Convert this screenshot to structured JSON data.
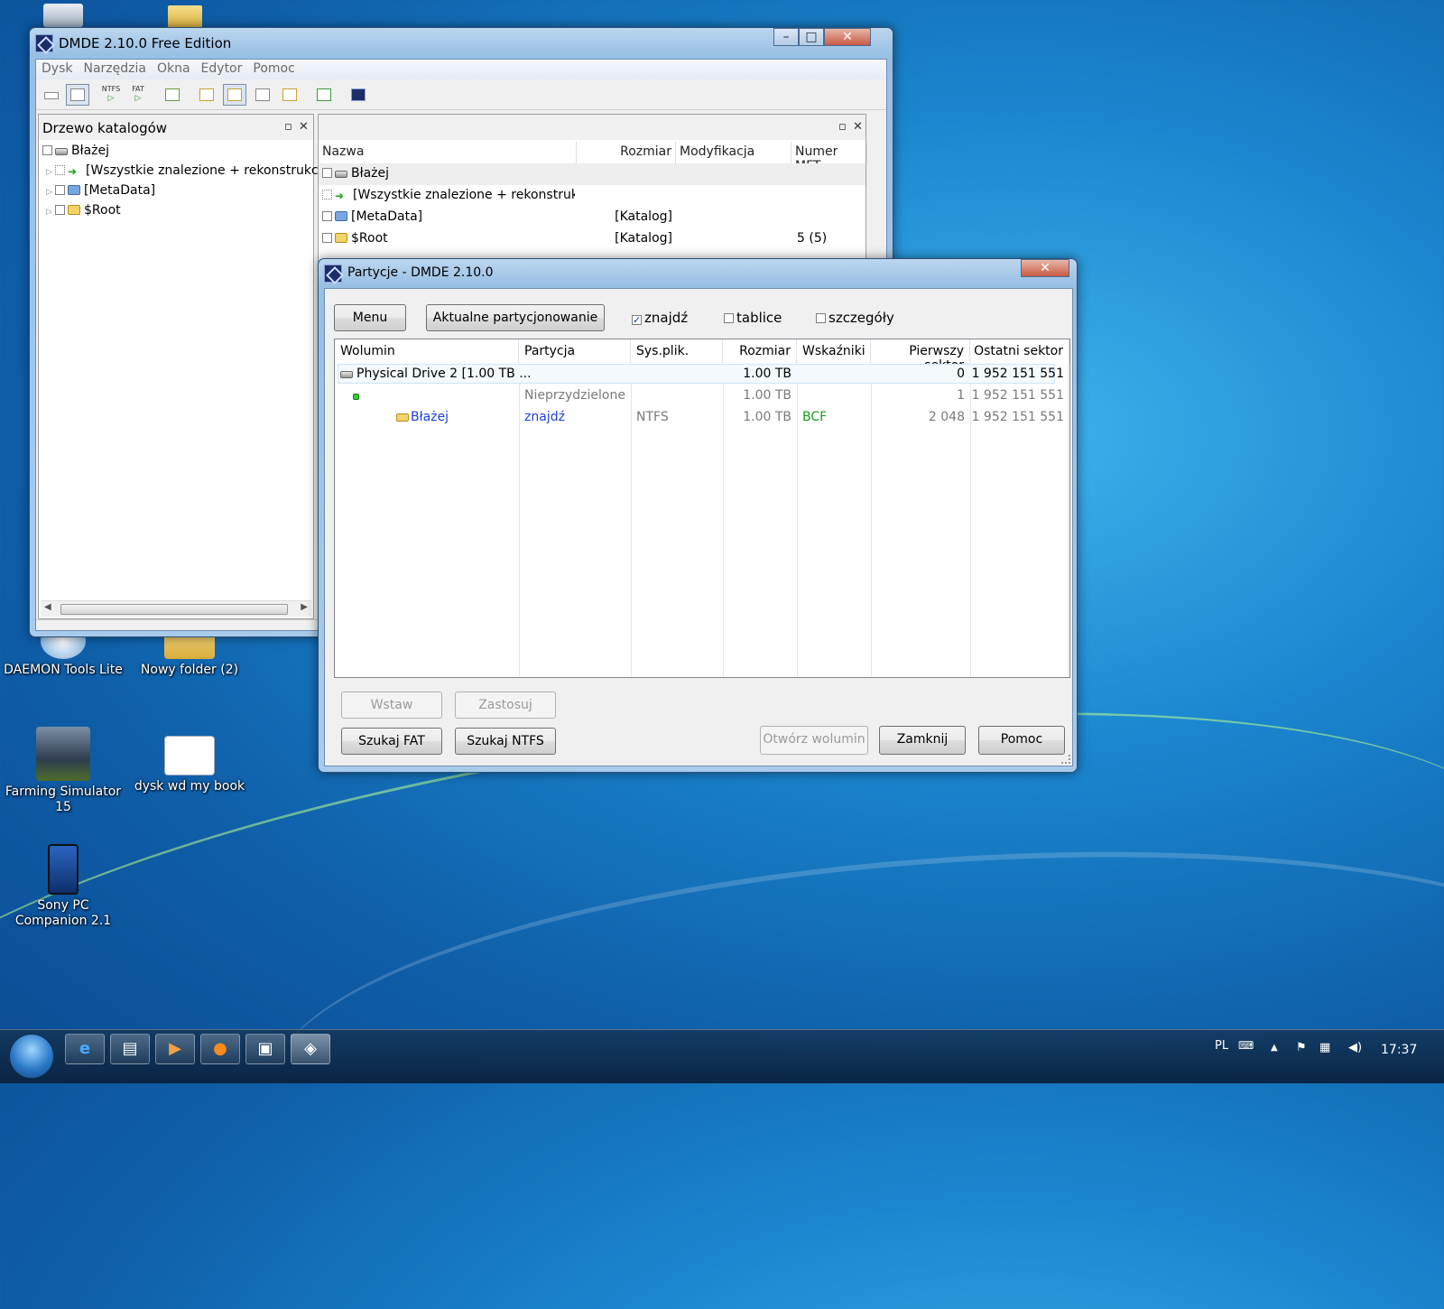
{
  "desktop": {
    "icons": [
      {
        "label": "DAEMON Tools Lite"
      },
      {
        "label": "Nowy folder (2)"
      },
      {
        "label": "Farming Simulator 15"
      },
      {
        "label": "dysk wd my book"
      },
      {
        "label": "Sony PC Companion 2.1"
      }
    ]
  },
  "main_window": {
    "title": "DMDE 2.10.0 Free Edition",
    "menu": [
      "Dysk",
      "Narzędzia",
      "Okna",
      "Edytor",
      "Pomoc"
    ],
    "toolbar": {
      "ntfs_label": "NTFS",
      "fat_label": "FAT"
    },
    "tree_pane": {
      "title": "Drzewo katalogów",
      "items": [
        {
          "label": "Błażej"
        },
        {
          "label": "[Wszystkie znalezione + rekonstrukcja"
        },
        {
          "label": "[MetaData]"
        },
        {
          "label": "$Root"
        }
      ]
    },
    "list_pane": {
      "columns": [
        "Nazwa",
        "Rozmiar",
        "Modyfikacja",
        "Numer MFT"
      ],
      "rows": [
        {
          "name": "Błażej",
          "size": "",
          "modified": "",
          "mft": ""
        },
        {
          "name": "[Wszystkie znalezione + rekonstrukc...",
          "size": "",
          "modified": "",
          "mft": ""
        },
        {
          "name": "[MetaData]",
          "size": "[Katalog]",
          "modified": "",
          "mft": ""
        },
        {
          "name": "$Root",
          "size": "[Katalog]",
          "modified": "",
          "mft": "5 (5)"
        }
      ]
    }
  },
  "partitions_dialog": {
    "title": "Partycje - DMDE 2.10.0",
    "menu_button": "Menu",
    "current_button": "Aktualne partycjonowanie",
    "checkboxes": [
      {
        "label": "znajdź",
        "checked": true
      },
      {
        "label": "tablice",
        "checked": false
      },
      {
        "label": "szczegóły",
        "checked": false
      }
    ],
    "columns": [
      "Wolumin",
      "Partycja",
      "Sys.plik.",
      "Rozmiar",
      "Wskaźniki",
      "Pierwszy sektor",
      "Ostatni sektor"
    ],
    "rows": [
      {
        "volume": "Physical Drive 2 [1.00 TB ...",
        "partition": "",
        "fs": "",
        "size": "1.00 TB",
        "flags": "",
        "first": "0",
        "last": "1 952 151 551"
      },
      {
        "volume": "",
        "partition": "Nieprzydzielone",
        "fs": "",
        "size": "1.00 TB",
        "flags": "",
        "first": "1",
        "last": "1 952 151 551"
      },
      {
        "volume": "Błażej",
        "partition": "znajdź",
        "fs": "NTFS",
        "size": "1.00 TB",
        "flags": "BCF",
        "first": "2 048",
        "last": "1 952 151 551"
      }
    ],
    "buttons": {
      "insert": "Wstaw",
      "apply": "Zastosuj",
      "search_fat": "Szukaj FAT",
      "search_ntfs": "Szukaj NTFS",
      "open_volume": "Otwórz wolumin",
      "close": "Zamknij",
      "help": "Pomoc"
    }
  },
  "taskbar": {
    "language": "PL",
    "time": "17:37"
  },
  "colors": {
    "found_text": "#1a3fd6",
    "flags_text": "#1a9a1a",
    "gray_text": "#7a7a7a"
  }
}
